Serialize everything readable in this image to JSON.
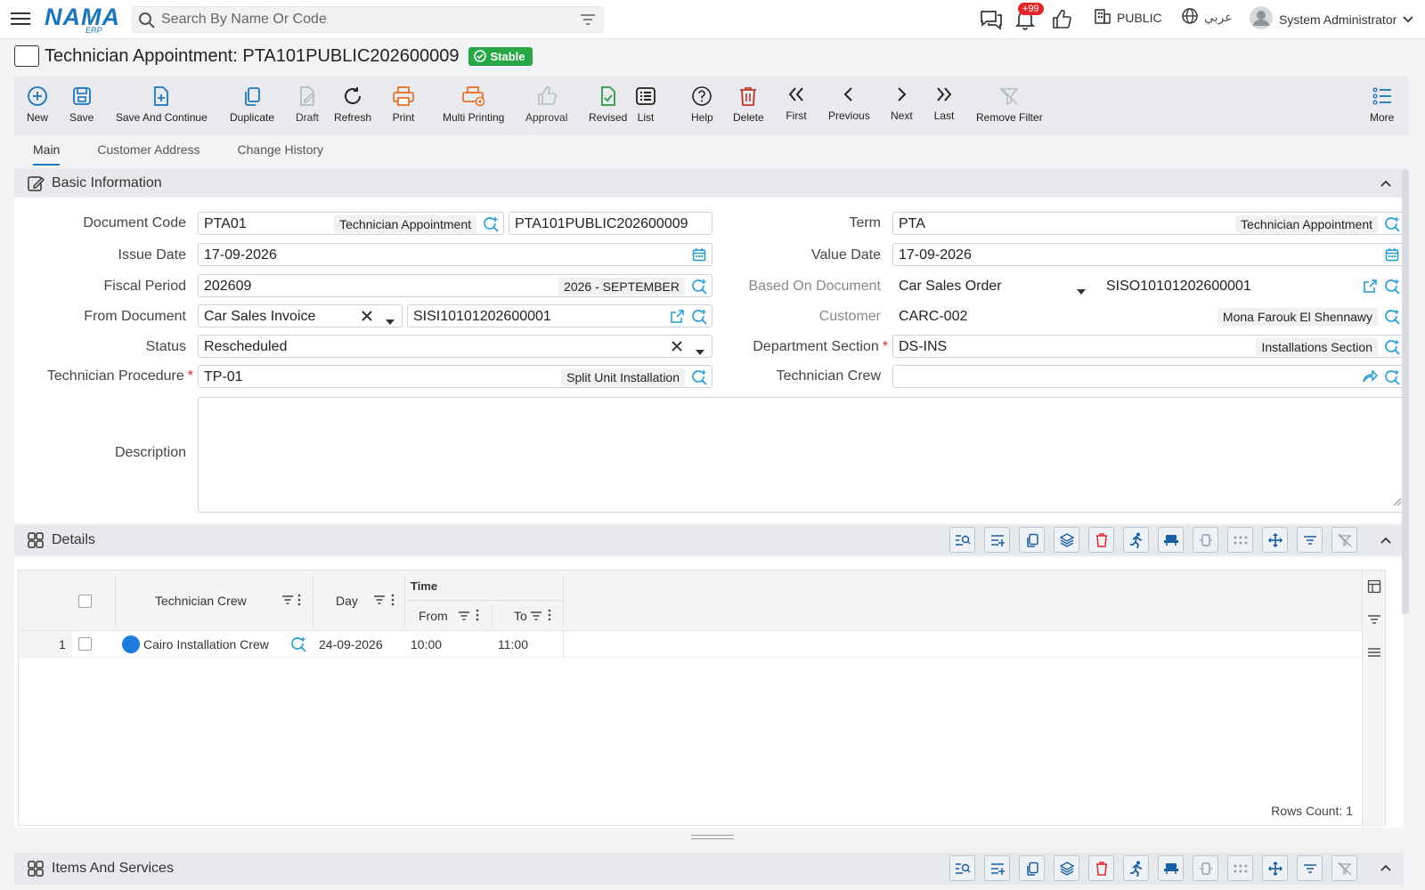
{
  "topbar": {
    "search_placeholder": "Search By Name Or Code",
    "notifications_count": "+99",
    "branch": "PUBLIC",
    "language": "عربي",
    "user": "System Administrator",
    "logo_text": "NAMA",
    "logo_sub": "ERP"
  },
  "document": {
    "title": "Technician Appointment: PTA101PUBLIC202600009",
    "status": "Stable"
  },
  "toolbar": {
    "new": "New",
    "save": "Save",
    "save_continue": "Save And Continue",
    "duplicate": "Duplicate",
    "draft": "Draft",
    "refresh": "Refresh",
    "print": "Print",
    "multi_printing": "Multi Printing",
    "approval": "Approval",
    "revised": "Revised",
    "list": "List",
    "help": "Help",
    "delete": "Delete",
    "first": "First",
    "previous": "Previous",
    "next": "Next",
    "last": "Last",
    "remove_filter": "Remove Filter",
    "more": "More"
  },
  "tabs": [
    "Main",
    "Customer Address",
    "Change History"
  ],
  "sections": {
    "basic": "Basic Information",
    "details": "Details",
    "items": "Items And Services"
  },
  "form": {
    "document_code": {
      "label": "Document Code",
      "code": "PTA01",
      "name": "Technician Appointment",
      "number": "PTA101PUBLIC202600009"
    },
    "issue_date": {
      "label": "Issue Date",
      "value": "17-09-2026"
    },
    "fiscal_period": {
      "label": "Fiscal Period",
      "code": "202609",
      "name": "2026 - SEPTEMBER"
    },
    "from_document": {
      "label": "From Document",
      "type": "Car Sales Invoice",
      "number": "SISI10101202600001"
    },
    "status": {
      "label": "Status",
      "value": "Rescheduled"
    },
    "technician_procedure": {
      "label": "Technician Procedure",
      "code": "TP-01",
      "name": "Split Unit Installation"
    },
    "term": {
      "label": "Term",
      "code": "PTA",
      "name": "Technician Appointment"
    },
    "value_date": {
      "label": "Value Date",
      "value": "17-09-2026"
    },
    "based_on_document": {
      "label": "Based On Document",
      "type": "Car Sales Order",
      "number": "SISO10101202600001"
    },
    "customer": {
      "label": "Customer",
      "code": "CARC-002",
      "name": "Mona Farouk El Shennawy"
    },
    "department_section": {
      "label": "Department Section",
      "code": "DS-INS",
      "name": "Installations Section"
    },
    "technician_crew": {
      "label": "Technician Crew",
      "value": ""
    },
    "description": {
      "label": "Description",
      "value": ""
    }
  },
  "grid": {
    "columns": {
      "crew": "Technician Crew",
      "day": "Day",
      "time": "Time",
      "from": "From",
      "to": "To"
    },
    "rows": [
      {
        "num": "1",
        "crew": "Cairo Installation Crew",
        "day": "24-09-2026",
        "from": "10:00",
        "to": "11:00"
      }
    ],
    "rows_count": "Rows Count: 1"
  },
  "colors": {
    "accent": "#1b76bc",
    "stable": "#27a844",
    "danger": "#e0262c",
    "print": "#e8712b"
  }
}
